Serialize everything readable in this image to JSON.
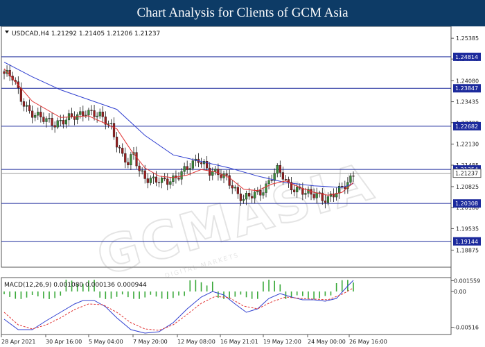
{
  "banner": {
    "title": "Chart Analysis for Clients of GCM Asia"
  },
  "watermark": {
    "text": "GCMASIA",
    "subtext": "DIGITAL MARKETS"
  },
  "colors": {
    "bull": "#3a8d3a",
    "bear": "#9c1f1f",
    "ma_fast": "#e03131",
    "ma_slow": "#2f3fd0",
    "level_line": "#1c2a9c",
    "price_line": "#9a9a9a",
    "macd_line": "#2f3fd0",
    "signal_line": "#e03131",
    "hist_pos": "#38a838",
    "label_bg": "#1c2a9c"
  },
  "chart_data": [
    {
      "type": "candlestick",
      "symbol": "USDCAD,H4",
      "header": "USDCAD,H4  1.21292 1.21405 1.21206 1.21237",
      "ylim": [
        1.1835,
        1.2575
      ],
      "y_ticks": [
        "1.25385",
        "1.24745",
        "1.24080",
        "1.23435",
        "1.22790",
        "1.22130",
        "1.21485",
        "1.20825",
        "1.20180",
        "1.19535",
        "1.18875"
      ],
      "x_labels": [
        "28 Apr 2021",
        "30 Apr 16:00",
        "5 May 04:00",
        "7 May 20:00",
        "12 May 08:00",
        "16 May 21:01",
        "19 May 12:00",
        "24 May 00:00",
        "26 May 16:00"
      ],
      "levels": [
        "1.24814",
        "1.23847",
        "1.22682",
        "1.21354",
        "1.20308",
        "1.19144"
      ],
      "current_price": "1.21237",
      "close_path": [
        [
          0,
          1.243
        ],
        [
          3,
          1.2415
        ],
        [
          6,
          1.2355
        ],
        [
          9,
          1.2315
        ],
        [
          12,
          1.2295
        ],
        [
          15,
          1.2285
        ],
        [
          18,
          1.228
        ],
        [
          21,
          1.2285
        ],
        [
          24,
          1.2292
        ],
        [
          27,
          1.2305
        ],
        [
          29,
          1.2318
        ],
        [
          31,
          1.231
        ],
        [
          33,
          1.23
        ],
        [
          35,
          1.229
        ],
        [
          38,
          1.227
        ],
        [
          40,
          1.222
        ],
        [
          42,
          1.2175
        ],
        [
          44,
          1.215
        ],
        [
          46,
          1.218
        ],
        [
          48,
          1.2135
        ],
        [
          50,
          1.2115
        ],
        [
          53,
          1.21
        ],
        [
          56,
          1.2095
        ],
        [
          59,
          1.2105
        ],
        [
          62,
          1.212
        ],
        [
          65,
          1.2135
        ],
        [
          67,
          1.215
        ],
        [
          69,
          1.217
        ],
        [
          71,
          1.2155
        ],
        [
          73,
          1.213
        ],
        [
          75,
          1.212
        ],
        [
          77,
          1.2115
        ],
        [
          79,
          1.211
        ],
        [
          81,
          1.209
        ],
        [
          83,
          1.206
        ],
        [
          85,
          1.204
        ],
        [
          87,
          1.205
        ],
        [
          89,
          1.206
        ],
        [
          91,
          1.207
        ],
        [
          93,
          1.2085
        ],
        [
          95,
          1.211
        ],
        [
          97,
          1.213
        ],
        [
          99,
          1.2115
        ],
        [
          101,
          1.209
        ],
        [
          103,
          1.208
        ],
        [
          105,
          1.207
        ],
        [
          107,
          1.206
        ],
        [
          109,
          1.2055
        ],
        [
          111,
          1.2065
        ],
        [
          113,
          1.205
        ],
        [
          115,
          1.2045
        ],
        [
          117,
          1.2055
        ],
        [
          119,
          1.2068
        ],
        [
          121,
          1.209
        ],
        [
          123,
          1.211
        ],
        [
          124,
          1.2124
        ]
      ],
      "ma_fast_path": [
        [
          0,
          1.2445
        ],
        [
          10,
          1.2345
        ],
        [
          20,
          1.2295
        ],
        [
          30,
          1.23
        ],
        [
          40,
          1.226
        ],
        [
          45,
          1.2195
        ],
        [
          50,
          1.214
        ],
        [
          55,
          1.2115
        ],
        [
          60,
          1.211
        ],
        [
          65,
          1.2118
        ],
        [
          70,
          1.2135
        ],
        [
          75,
          1.2128
        ],
        [
          80,
          1.211
        ],
        [
          85,
          1.2075
        ],
        [
          90,
          1.207
        ],
        [
          95,
          1.209
        ],
        [
          100,
          1.21
        ],
        [
          105,
          1.208
        ],
        [
          110,
          1.2065
        ],
        [
          115,
          1.2056
        ],
        [
          120,
          1.2065
        ],
        [
          124,
          1.2095
        ]
      ],
      "ma_slow_path": [
        [
          0,
          1.2465
        ],
        [
          10,
          1.242
        ],
        [
          20,
          1.238
        ],
        [
          30,
          1.235
        ],
        [
          40,
          1.232
        ],
        [
          50,
          1.224
        ],
        [
          60,
          1.218
        ],
        [
          70,
          1.216
        ],
        [
          80,
          1.214
        ],
        [
          90,
          1.2115
        ],
        [
          100,
          1.2095
        ],
        [
          110,
          1.2085
        ],
        [
          120,
          1.208
        ],
        [
          124,
          1.2092
        ]
      ]
    },
    {
      "type": "macd",
      "label": "MACD(12,26,9) 0.001080 0.000136 0.000944",
      "ylim": [
        -0.0062,
        0.002
      ],
      "y_ticks": [
        "0.001559",
        "0.00",
        "-0.00516"
      ],
      "macd_path": [
        [
          0,
          -0.004
        ],
        [
          5,
          -0.0055
        ],
        [
          10,
          -0.0055
        ],
        [
          15,
          -0.0042
        ],
        [
          20,
          -0.003
        ],
        [
          25,
          -0.0018
        ],
        [
          28,
          -0.0013
        ],
        [
          32,
          -0.0013
        ],
        [
          36,
          -0.0022
        ],
        [
          40,
          -0.0038
        ],
        [
          45,
          -0.0055
        ],
        [
          50,
          -0.006
        ],
        [
          55,
          -0.0058
        ],
        [
          60,
          -0.0045
        ],
        [
          65,
          -0.0025
        ],
        [
          70,
          -0.0008
        ],
        [
          74,
          0.0
        ],
        [
          78,
          -0.0005
        ],
        [
          82,
          -0.0018
        ],
        [
          86,
          -0.003
        ],
        [
          90,
          -0.0025
        ],
        [
          94,
          -0.001
        ],
        [
          98,
          -0.0003
        ],
        [
          102,
          -0.0008
        ],
        [
          106,
          -0.0012
        ],
        [
          110,
          -0.0012
        ],
        [
          114,
          -0.0014
        ],
        [
          118,
          -0.001
        ],
        [
          122,
          0.0008
        ],
        [
          124,
          0.0016
        ]
      ],
      "signal_path": [
        [
          0,
          -0.003
        ],
        [
          5,
          -0.0048
        ],
        [
          10,
          -0.0054
        ],
        [
          15,
          -0.0048
        ],
        [
          20,
          -0.0038
        ],
        [
          25,
          -0.0026
        ],
        [
          30,
          -0.0018
        ],
        [
          35,
          -0.0019
        ],
        [
          40,
          -0.003
        ],
        [
          45,
          -0.0045
        ],
        [
          50,
          -0.0054
        ],
        [
          55,
          -0.0056
        ],
        [
          60,
          -0.0048
        ],
        [
          65,
          -0.0033
        ],
        [
          70,
          -0.0017
        ],
        [
          75,
          -0.0007
        ],
        [
          80,
          -0.0009
        ],
        [
          85,
          -0.0021
        ],
        [
          90,
          -0.0025
        ],
        [
          95,
          -0.0015
        ],
        [
          100,
          -0.0008
        ],
        [
          105,
          -0.001
        ],
        [
          110,
          -0.0011
        ],
        [
          115,
          -0.0012
        ],
        [
          120,
          -0.0004
        ],
        [
          124,
          0.0005
        ]
      ],
      "hist_pos_ranges": [
        [
          22,
          33
        ],
        [
          66,
          75
        ],
        [
          91,
          99
        ],
        [
          118,
          124
        ]
      ],
      "hist_neg_ranges": [
        [
          0,
          21
        ],
        [
          34,
          60
        ],
        [
          76,
          90
        ],
        [
          100,
          117
        ]
      ]
    }
  ]
}
